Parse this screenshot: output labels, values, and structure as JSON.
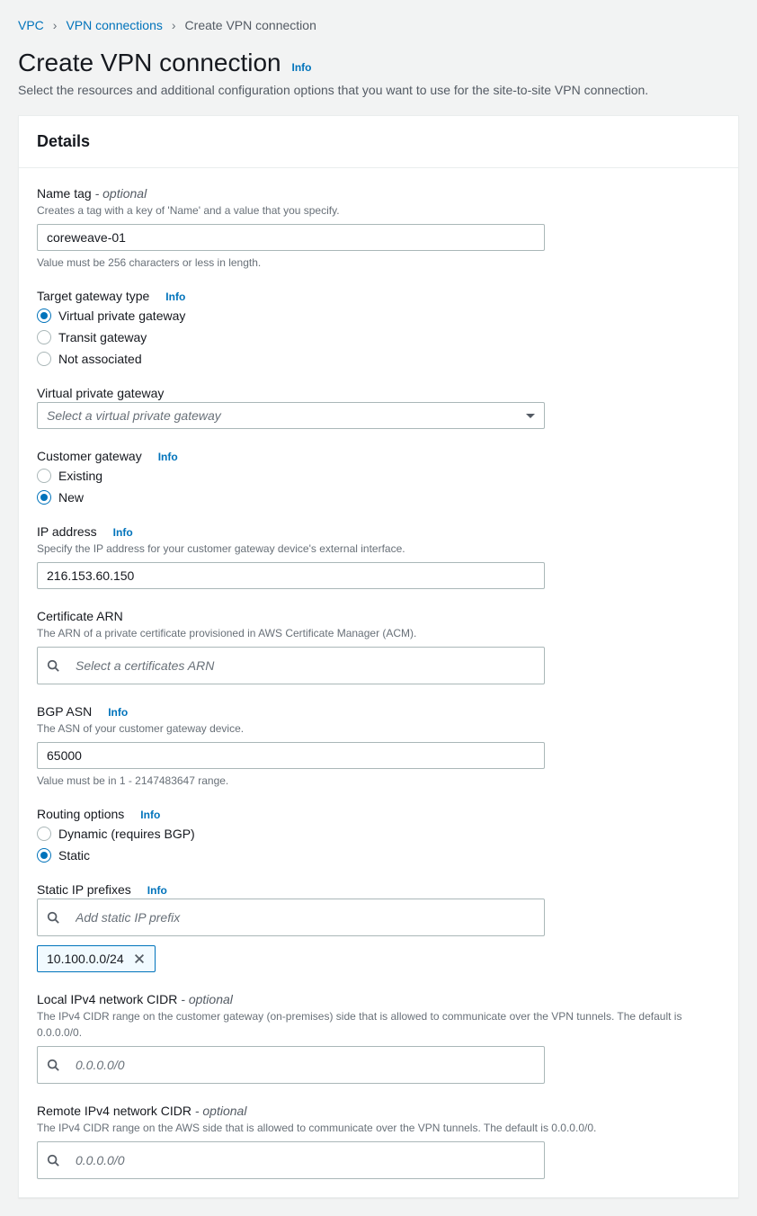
{
  "breadcrumb": {
    "items": [
      "VPC",
      "VPN connections",
      "Create VPN connection"
    ]
  },
  "header": {
    "title": "Create VPN connection",
    "info": "Info",
    "subtitle": "Select the resources and additional configuration options that you want to use for the site-to-site VPN connection."
  },
  "panel": {
    "title": "Details"
  },
  "fields": {
    "name_tag": {
      "label": "Name tag",
      "optional": "- optional",
      "desc": "Creates a tag with a key of 'Name' and a value that you specify.",
      "value": "coreweave-01",
      "hint": "Value must be 256 characters or less in length."
    },
    "target_gateway_type": {
      "label": "Target gateway type",
      "info": "Info",
      "options": [
        "Virtual private gateway",
        "Transit gateway",
        "Not associated"
      ],
      "selected": 0
    },
    "vpg": {
      "label": "Virtual private gateway",
      "placeholder": "Select a virtual private gateway"
    },
    "customer_gateway": {
      "label": "Customer gateway",
      "info": "Info",
      "options": [
        "Existing",
        "New"
      ],
      "selected": 1
    },
    "ip_address": {
      "label": "IP address",
      "info": "Info",
      "desc": "Specify the IP address for your customer gateway device's external interface.",
      "value": "216.153.60.150"
    },
    "certificate_arn": {
      "label": "Certificate ARN",
      "desc": "The ARN of a private certificate provisioned in AWS Certificate Manager (ACM).",
      "placeholder": "Select a certificates ARN"
    },
    "bgp_asn": {
      "label": "BGP ASN",
      "info": "Info",
      "desc": "The ASN of your customer gateway device.",
      "value": "65000",
      "hint": "Value must be in 1 - 2147483647 range."
    },
    "routing_options": {
      "label": "Routing options",
      "info": "Info",
      "options": [
        "Dynamic (requires BGP)",
        "Static"
      ],
      "selected": 1
    },
    "static_prefixes": {
      "label": "Static IP prefixes",
      "info": "Info",
      "placeholder": "Add static IP prefix",
      "tokens": [
        "10.100.0.0/24"
      ]
    },
    "local_cidr": {
      "label": "Local IPv4 network CIDR",
      "optional": "- optional",
      "desc": "The IPv4 CIDR range on the customer gateway (on-premises) side that is allowed to communicate over the VPN tunnels. The default is 0.0.0.0/0.",
      "placeholder": "0.0.0.0/0"
    },
    "remote_cidr": {
      "label": "Remote IPv4 network CIDR",
      "optional": "- optional",
      "desc": "The IPv4 CIDR range on the AWS side that is allowed to communicate over the VPN tunnels. The default is 0.0.0.0/0.",
      "placeholder": "0.0.0.0/0"
    }
  }
}
